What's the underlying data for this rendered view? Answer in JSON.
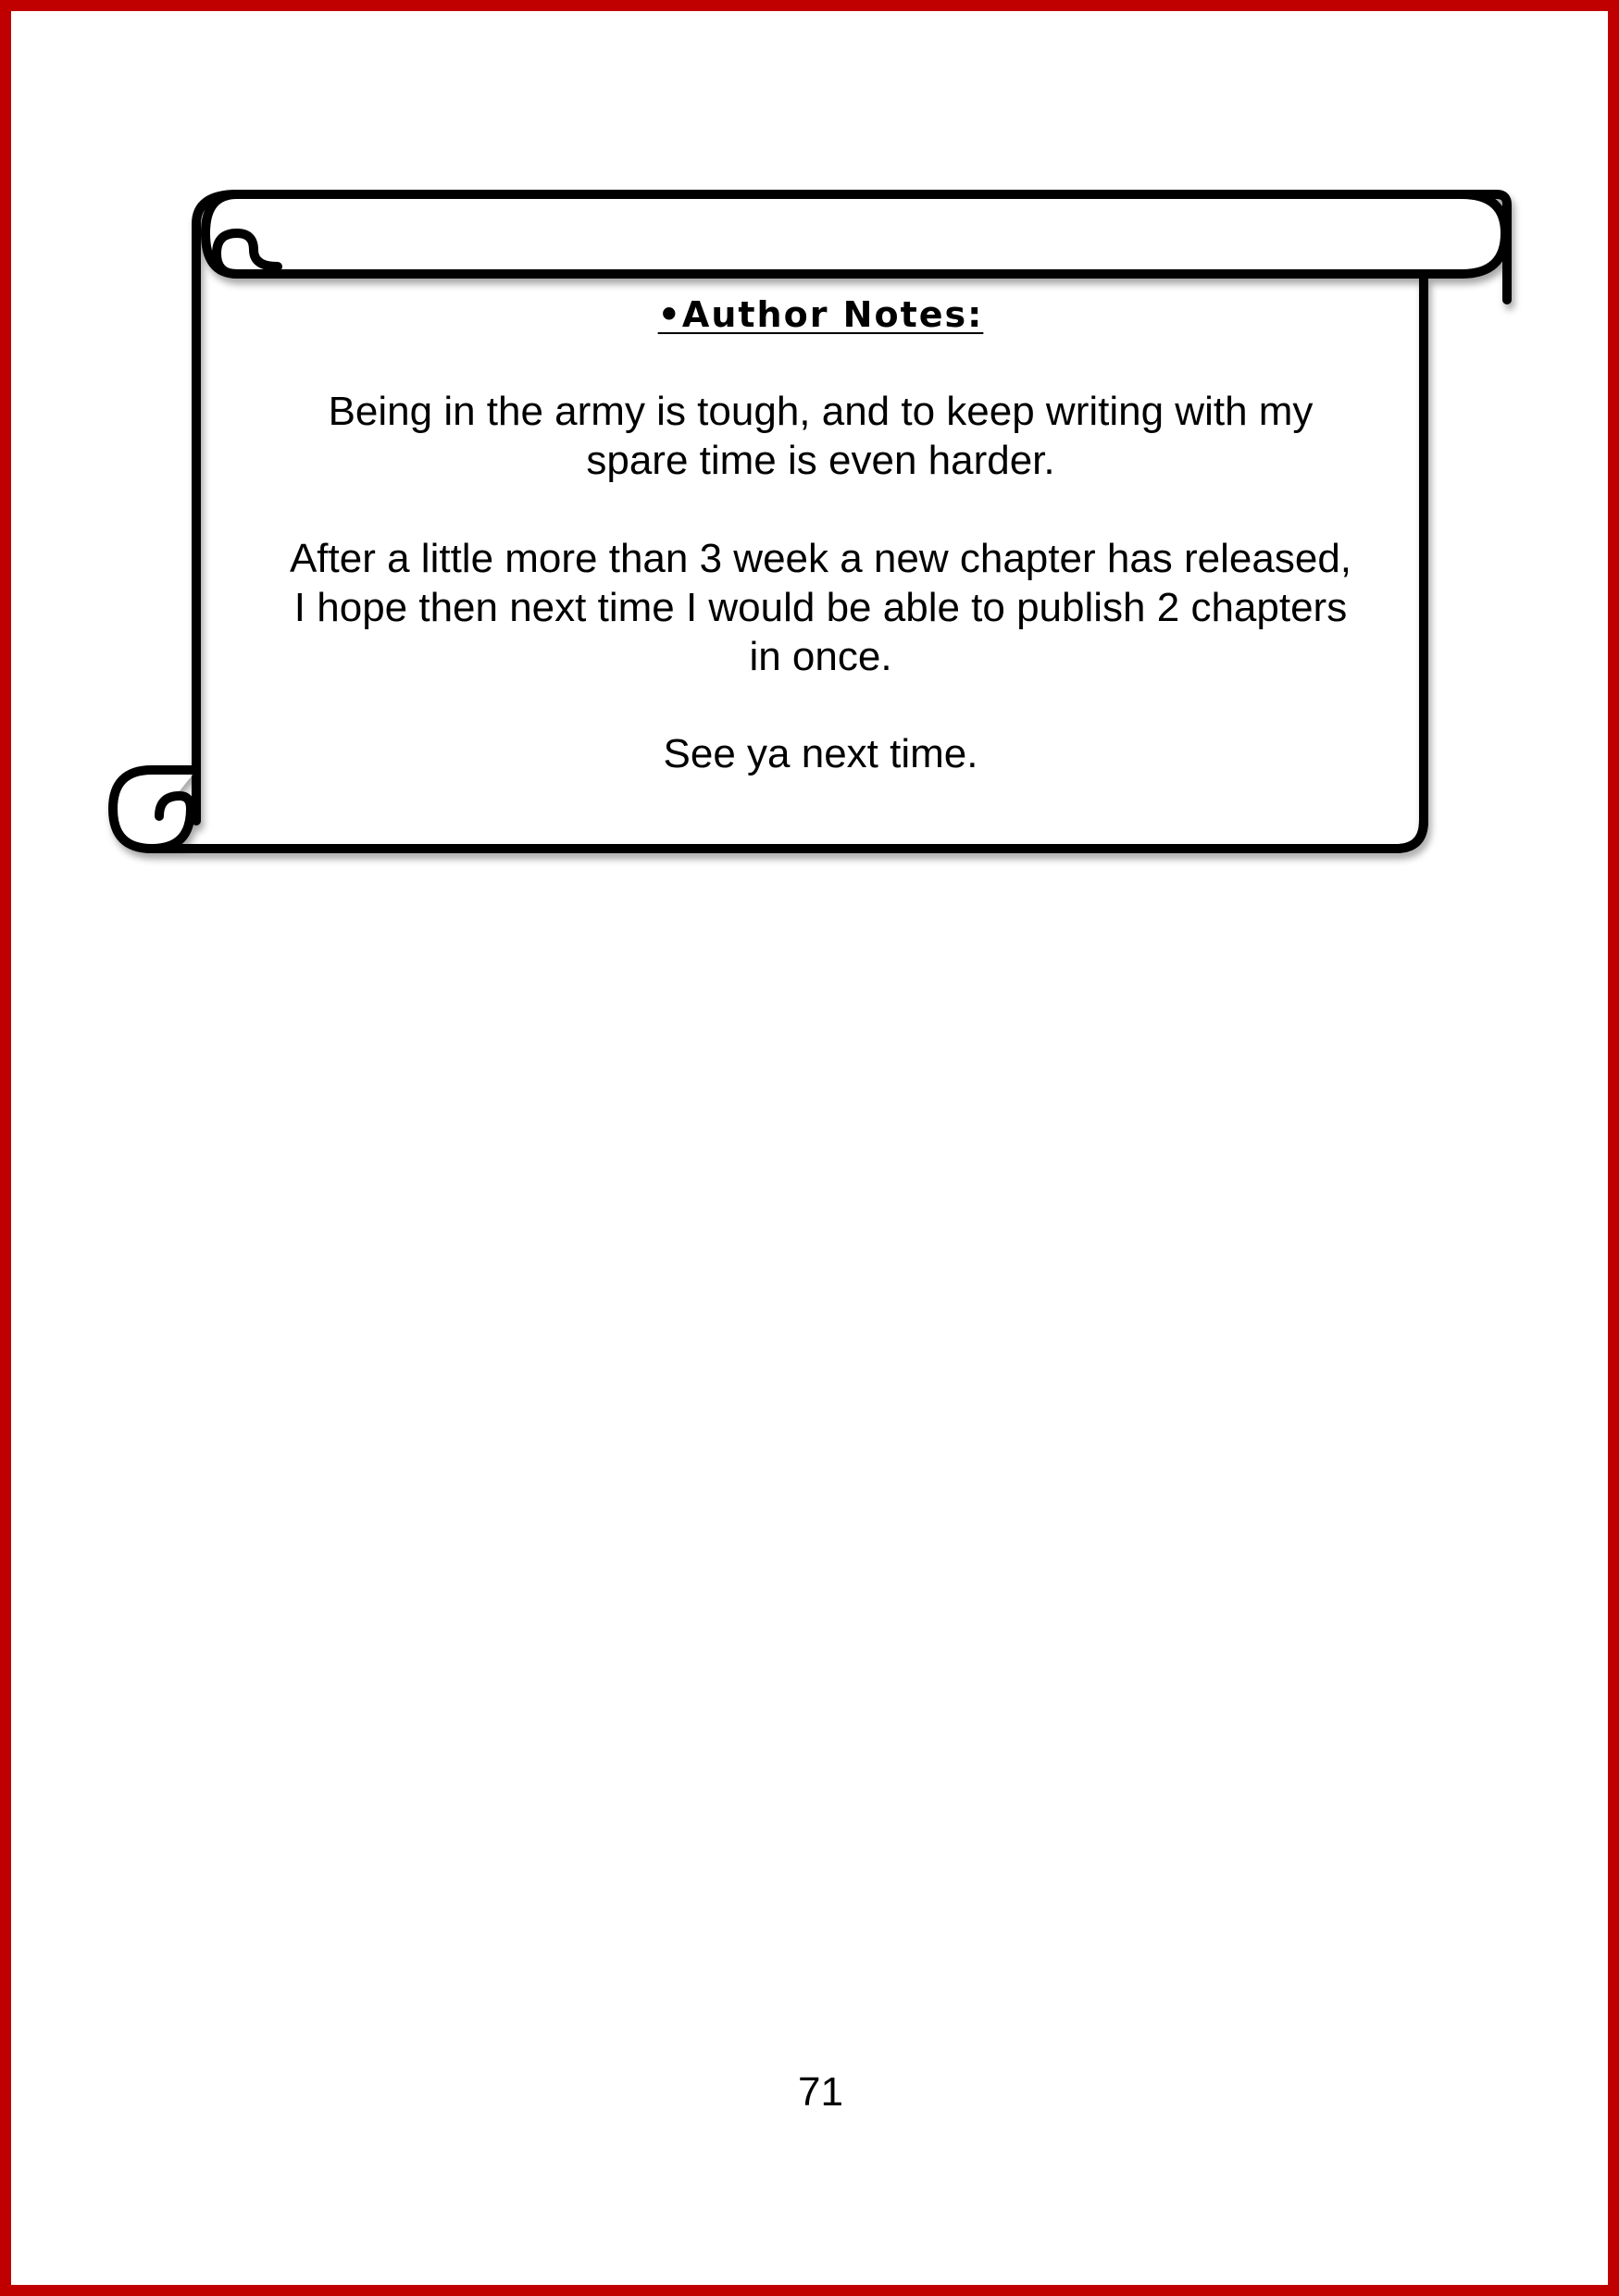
{
  "page": {
    "border_color": "#c00000"
  },
  "author_notes": {
    "heading": "•Author Notes:",
    "paragraph_1": "Being in the army is tough, and to keep writing with my spare time is even harder.",
    "paragraph_2": "After a little more than 3 week a new chapter has released, I hope then next time I would be able to publish 2 chapters in once.",
    "paragraph_3": "See ya next time."
  },
  "footer": {
    "page_number": "71"
  }
}
